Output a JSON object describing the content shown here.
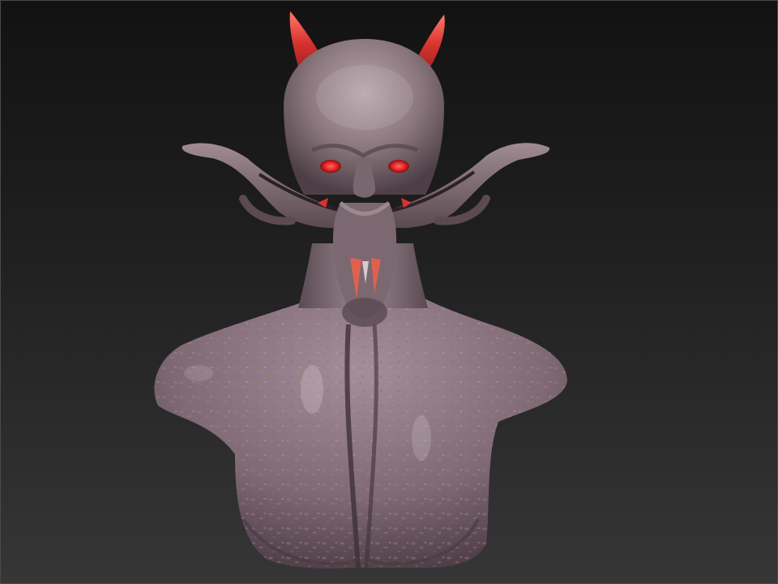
{
  "scene": {
    "subject": "",
    "palette": {
      "background_top": "#121212",
      "background_bottom": "#363636",
      "skin_base": "#8f7b82",
      "skin_shadow": "#4e3f46",
      "skin_highlight": "#c9b9bd",
      "speckle": "#a070a8",
      "horn": "#d8342f",
      "horn_tip": "#ff6a5a",
      "eye_glow": "#ff2a2a",
      "tusk": "#e06050"
    }
  }
}
